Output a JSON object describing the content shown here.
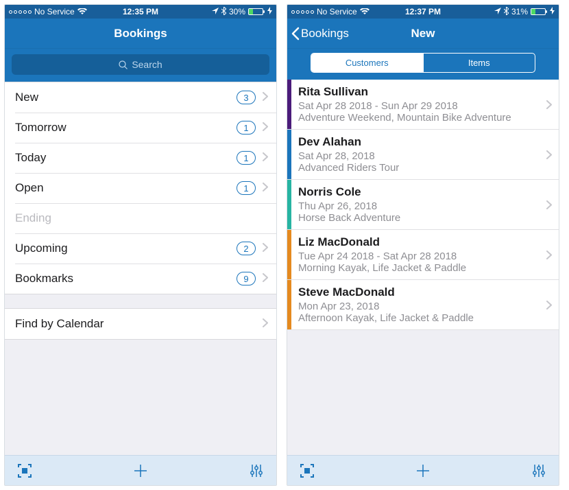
{
  "status": {
    "carrier": "No Service",
    "time_left": "12:35 PM",
    "time_right": "12:37 PM",
    "battery_left": "30%",
    "battery_right": "31%"
  },
  "left": {
    "title": "Bookings",
    "search_placeholder": "Search",
    "rows": [
      {
        "label": "New",
        "count": "3",
        "disabled": false
      },
      {
        "label": "Tomorrow",
        "count": "1",
        "disabled": false
      },
      {
        "label": "Today",
        "count": "1",
        "disabled": false
      },
      {
        "label": "Open",
        "count": "1",
        "disabled": false
      },
      {
        "label": "Ending",
        "count": null,
        "disabled": true
      },
      {
        "label": "Upcoming",
        "count": "2",
        "disabled": false
      },
      {
        "label": "Bookmarks",
        "count": "9",
        "disabled": false
      }
    ],
    "calendar_row": "Find by Calendar"
  },
  "right": {
    "back_label": "Bookings",
    "title": "New",
    "segments": {
      "left": "Customers",
      "right": "Items",
      "active": "left"
    },
    "customers": [
      {
        "color": "#4b1c7a",
        "name": "Rita Sullivan",
        "date": "Sat Apr 28 2018 - Sun Apr 29 2018",
        "products": "Adventure Weekend, Mountain Bike Adventure"
      },
      {
        "color": "#1b75bb",
        "name": "Dev Alahan",
        "date": "Sat Apr 28, 2018",
        "products": "Advanced Riders Tour"
      },
      {
        "color": "#27b4a2",
        "name": "Norris Cole",
        "date": "Thu Apr 26, 2018",
        "products": "Horse Back Adventure"
      },
      {
        "color": "#e58a1f",
        "name": "Liz MacDonald",
        "date": "Tue Apr 24 2018 - Sat Apr 28 2018",
        "products": "Morning Kayak, Life Jacket & Paddle"
      },
      {
        "color": "#e58a1f",
        "name": "Steve MacDonald",
        "date": "Mon Apr 23, 2018",
        "products": "Afternoon Kayak, Life Jacket & Paddle"
      }
    ]
  }
}
